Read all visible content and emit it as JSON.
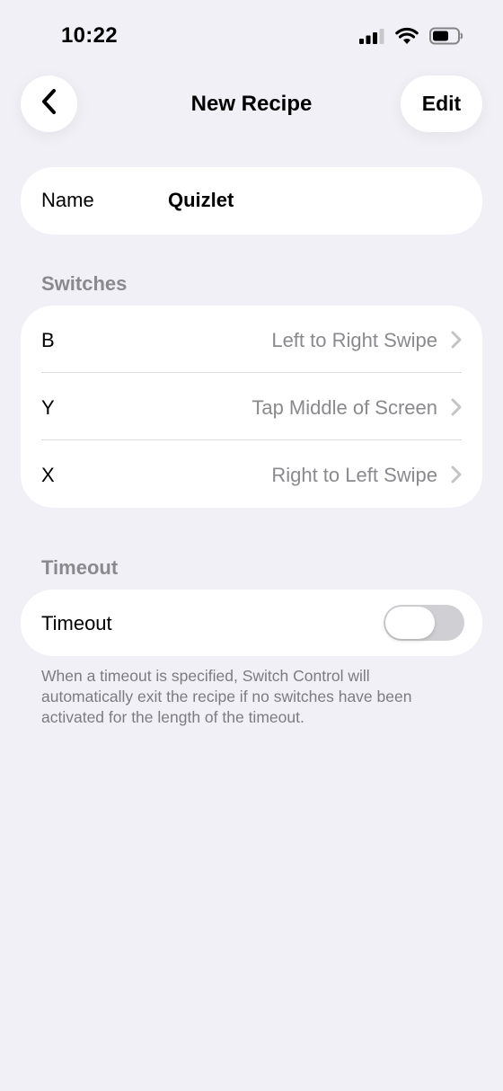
{
  "status_bar": {
    "time": "10:22",
    "icons": [
      "cellular-signal-icon",
      "wifi-icon",
      "battery-icon"
    ]
  },
  "nav": {
    "back_icon": "chevron-left-icon",
    "title": "New Recipe",
    "edit_label": "Edit"
  },
  "name_row": {
    "label": "Name",
    "value": "Quizlet"
  },
  "switches": {
    "header": "Switches",
    "items": [
      {
        "key": "B",
        "action": "Left to Right Swipe"
      },
      {
        "key": "Y",
        "action": "Tap Middle of Screen"
      },
      {
        "key": "X",
        "action": "Right to Left Swipe"
      }
    ]
  },
  "timeout": {
    "header": "Timeout",
    "label": "Timeout",
    "enabled": false,
    "note": "When a timeout is specified, Switch Control will automatically exit the recipe if no switches have been activated for the length of the timeout."
  },
  "colors": {
    "background": "#f1f0f6",
    "card": "#ffffff",
    "secondary_text": "#8a8a8e",
    "toggle_off": "#d0d0d4"
  }
}
